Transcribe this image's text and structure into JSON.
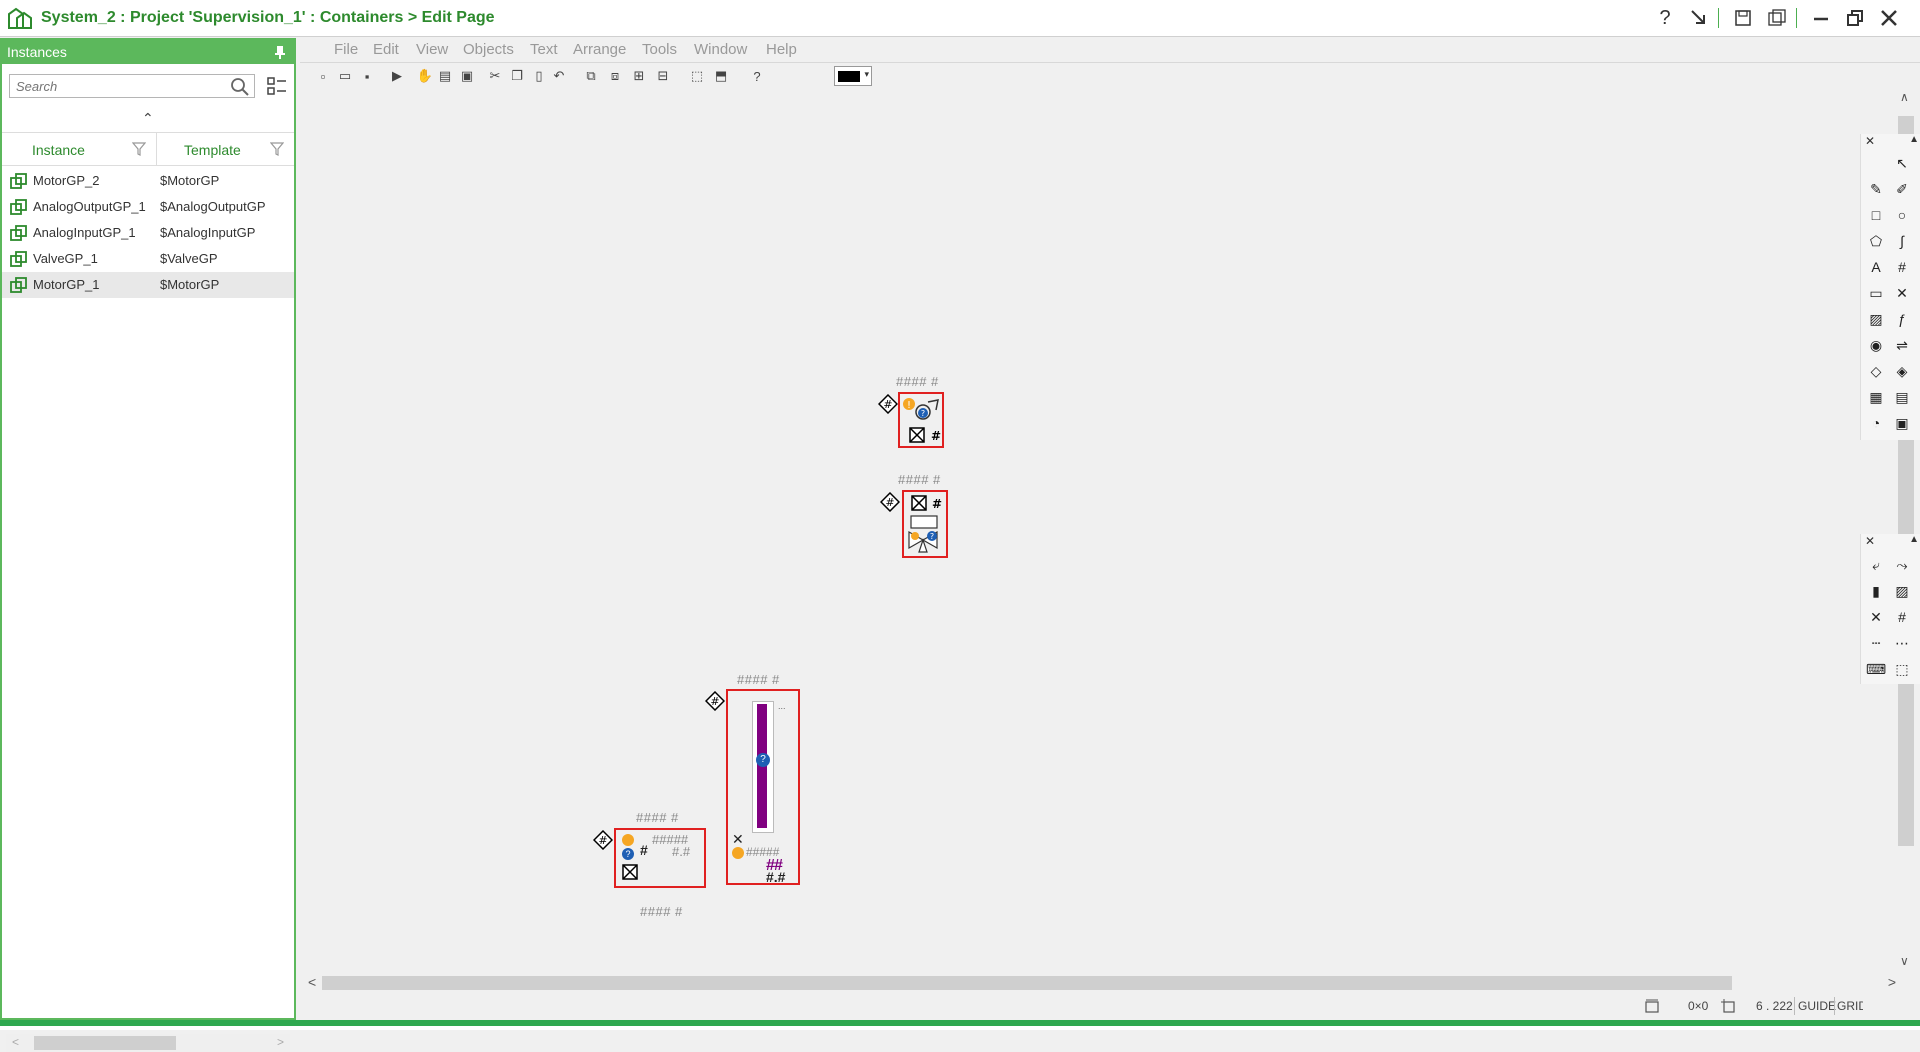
{
  "window": {
    "title": "System_2 : Project 'Supervision_1' : Containers > Edit Page",
    "accent_color": "#2d8a2d",
    "buttons": [
      "help-icon",
      "dock-icon",
      "save-icon",
      "save-all-icon",
      "minimize-icon",
      "restore-icon",
      "close-icon"
    ]
  },
  "instances_pane": {
    "title": "Instances",
    "search_placeholder": "Search",
    "columns": {
      "instance": "Instance",
      "template": "Template"
    },
    "rows": [
      {
        "instance": "MotorGP_2",
        "template": "$MotorGP",
        "selected": false
      },
      {
        "instance": "AnalogOutputGP_1",
        "template": "$AnalogOutputGP",
        "selected": false
      },
      {
        "instance": "AnalogInputGP_1",
        "template": "$AnalogInputGP",
        "selected": false
      },
      {
        "instance": "ValveGP_1",
        "template": "$ValveGP",
        "selected": false
      },
      {
        "instance": "MotorGP_1",
        "template": "$MotorGP",
        "selected": true
      }
    ]
  },
  "menu": [
    "File",
    "Edit",
    "View",
    "Objects",
    "Text",
    "Arrange",
    "Tools",
    "Window",
    "Help"
  ],
  "toolbar": {
    "tools": [
      "new-icon",
      "open-icon",
      "save-icon",
      "run-icon",
      "hand-icon",
      "properties-icon",
      "preview-icon",
      "cut-icon",
      "copy-icon",
      "paste-icon",
      "undo-icon",
      "group-icon",
      "ungroup-icon",
      "align-icon",
      "distribute-icon",
      "resize-icon",
      "fit-icon",
      "help-icon"
    ],
    "current_color": "#000000"
  },
  "canvas": {
    "labels": {
      "motor2_top": "#### #",
      "valve_top": "#### #",
      "aout_top": "#### #",
      "ain_top": "#### #",
      "ain_bottom": "#### #",
      "ain_value": "#####",
      "ain_decimal": "#.#",
      "ain_hash": "#",
      "bar_value": "#####",
      "bar_decimal": "#.#",
      "bar_tiny": "..."
    },
    "symbol_color": "#e02020",
    "bar_color": "#800080"
  },
  "palettes": {
    "top": [
      "select-icon",
      "pencil-icon",
      "pen-icon",
      "rectangle-icon",
      "ellipse-icon",
      "polygon-icon",
      "curve-icon",
      "text-icon",
      "hash-icon",
      "button-icon",
      "cross-icon",
      "image-icon",
      "fx-icon",
      "camera-icon",
      "pipe-icon",
      "layer-icon",
      "layers-icon",
      "chart-icon",
      "table-icon",
      "gauge-icon",
      "gallery-icon"
    ],
    "bottom": [
      "link-icon",
      "split-icon",
      "battery-icon",
      "picture-icon",
      "tool-icon",
      "num-icon",
      "line-icon",
      "grid-icon",
      "keyboard-icon",
      "shape-icon"
    ]
  },
  "statusbar": {
    "size": "0×0",
    "position": "6 . 222",
    "guide": "GUIDE",
    "grid": "GRID"
  }
}
